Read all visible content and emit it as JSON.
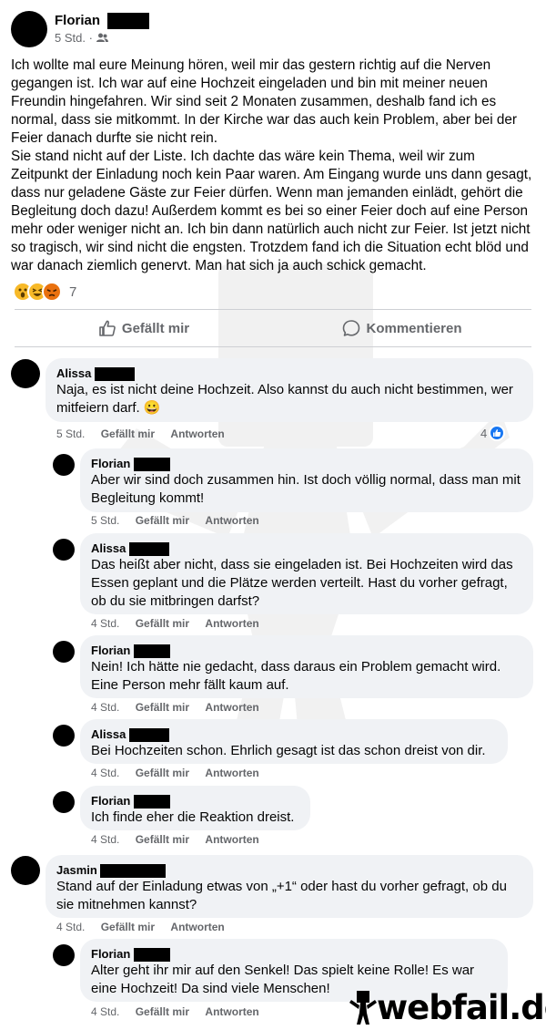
{
  "post": {
    "author": "Florian",
    "time": "5 Std.",
    "separator": "·",
    "paragraphs": [
      "Ich wollte mal eure Meinung hören, weil mir das gestern richtig auf die Nerven gegangen ist. Ich war auf eine Hochzeit eingeladen und bin mit meiner neuen Freundin hingefahren. Wir sind seit 2 Monaten zusammen, deshalb fand ich es normal, dass sie mitkommt. In der Kirche war das auch kein Problem, aber bei der Feier danach durfte sie nicht rein.",
      "Sie stand nicht auf der Liste. Ich dachte das wäre kein Thema, weil wir zum Zeitpunkt der Einladung noch kein Paar waren. Am Eingang wurde uns dann gesagt, dass nur geladene Gäste zur Feier dürfen. Wenn man jemanden einlädt, gehört die Begleitung doch dazu! Außerdem kommt es bei so einer Feier doch auf eine Person mehr oder weniger nicht an. Ich bin dann natürlich auch nicht zur Feier. Ist jetzt nicht so tragisch, wir sind nicht die engsten. Trotzdem fand ich die Situation echt blöd und war danach ziemlich genervt. Man hat sich ja auch schick gemacht."
    ],
    "reaction_count": "7",
    "reactions": [
      "wow-icon",
      "haha-icon",
      "angry-icon"
    ]
  },
  "actions": {
    "like": "Gefällt mir",
    "comment": "Kommentieren"
  },
  "footer_labels": {
    "like": "Gefällt mir",
    "reply": "Antworten"
  },
  "comments": [
    {
      "name": "Alissa",
      "text": "Naja, es ist nicht deine Hochzeit. Also kannst du auch nicht bestimmen, wer mitfeiern darf. 😀",
      "time": "5 Std.",
      "likes": "4"
    },
    {
      "name": "Florian",
      "text": "Aber wir sind doch zusammen hin. Ist doch völlig normal, dass man mit Begleitung kommt!",
      "time": "5 Std."
    },
    {
      "name": "Alissa",
      "text": "Das heißt aber nicht, dass sie eingeladen ist. Bei Hochzeiten wird das Essen geplant und die Plätze werden verteilt. Hast du vorher gefragt, ob du sie mitbringen darfst?",
      "time": "4 Std."
    },
    {
      "name": "Florian",
      "text": "Nein! Ich hätte nie gedacht, dass daraus ein Problem gemacht wird. Eine Person mehr fällt kaum auf.",
      "time": "4 Std."
    },
    {
      "name": "Alissa",
      "text": "Bei Hochzeiten schon. Ehrlich gesagt ist das schon dreist von dir.",
      "time": "4 Std."
    },
    {
      "name": "Florian",
      "text": "Ich finde eher die Reaktion dreist.",
      "time": "4 Std."
    },
    {
      "name": "Jasmin",
      "text": "Stand auf der Einladung etwas von „+1“ oder hast du vorher gefragt, ob du sie mitnehmen kannst?",
      "time": "4 Std."
    },
    {
      "name": "Florian",
      "text": "Alter geht ihr mir auf den Senkel! Das spielt keine Rolle! Es war eine Hochzeit! Da sind viele Menschen!",
      "time": "4 Std."
    }
  ],
  "watermark": {
    "logo_text": "webfail.de"
  },
  "colors": {
    "secondary_text": "#65676b",
    "bubble": "#f0f2f5",
    "like_blue": "#1877f2"
  }
}
